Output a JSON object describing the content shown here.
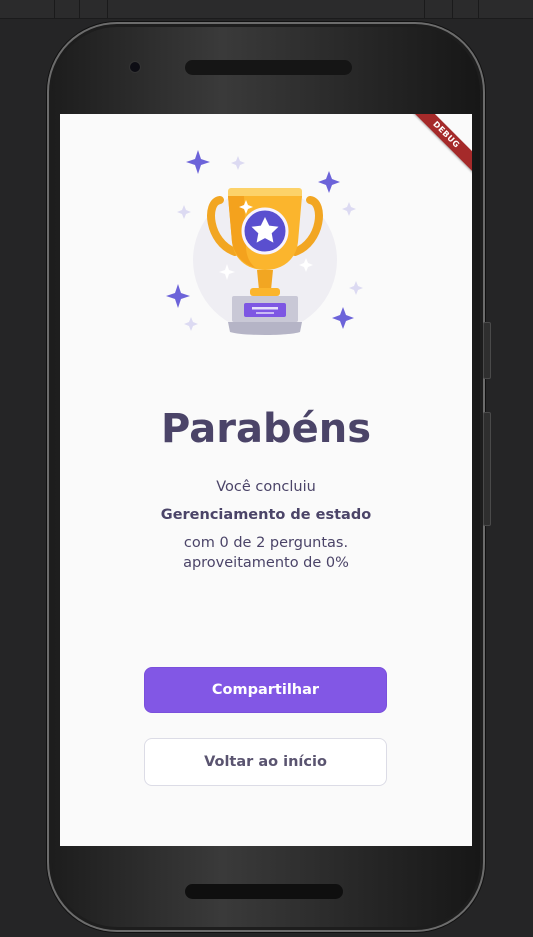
{
  "screen": {
    "debug_banner": "DEBUG",
    "illustration": "trophy-icon",
    "title": "Parabéns",
    "completed_prefix": "Você concluiu",
    "quiz_name": "Gerenciamento de estado",
    "score_line": "com 0 de 2 perguntas.",
    "performance_line": "aproveitamento de 0%"
  },
  "actions": {
    "share_label": "Compartilhar",
    "back_label": "Voltar ao início"
  },
  "colors": {
    "primary": "#8257e5",
    "heading": "#4b4468",
    "trophy_gold": "#fbb52d",
    "background": "#fafafa"
  }
}
